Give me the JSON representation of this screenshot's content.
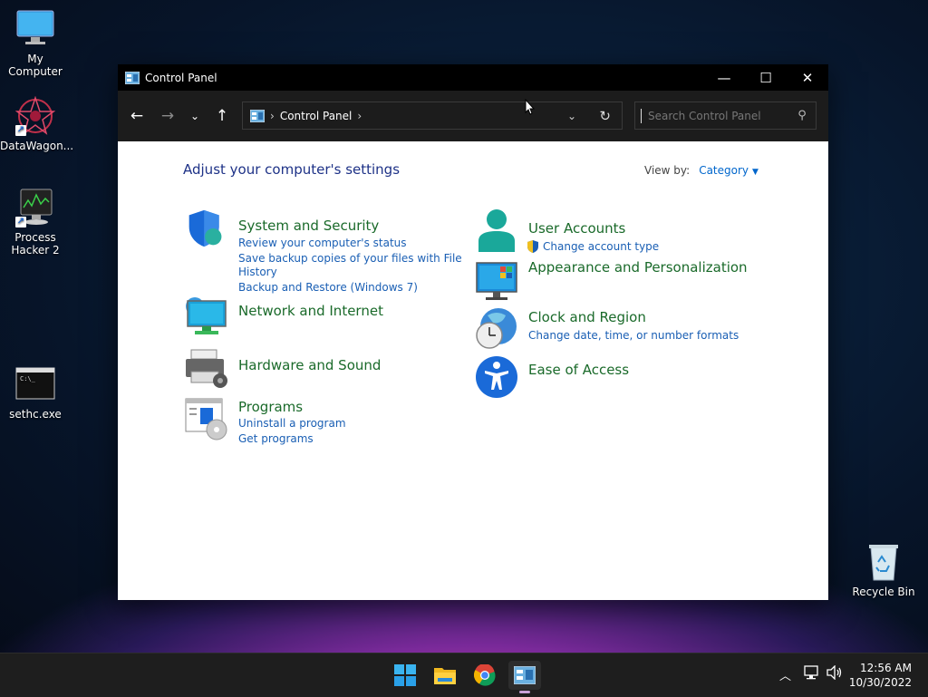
{
  "desktop": {
    "icons": [
      {
        "label": "My Computer",
        "icon": "monitor-icon"
      },
      {
        "label": "DataWagon...",
        "icon": "datawagon-icon"
      },
      {
        "label": "Process\nHacker 2",
        "icon": "process-hacker-icon"
      },
      {
        "label": "sethc.exe",
        "icon": "cmd-icon"
      },
      {
        "label": "Recycle Bin",
        "icon": "recycle-bin-icon"
      }
    ]
  },
  "window": {
    "title": "Control Panel",
    "address": {
      "crumb": "Control Panel",
      "sep": "›"
    },
    "search_placeholder": "Search Control Panel",
    "heading": "Adjust your computer's settings",
    "view_by_label": "View by:",
    "view_by_value": "Category"
  },
  "categories": {
    "system": {
      "title": "System and Security",
      "links": [
        "Review your computer's status",
        "Save backup copies of your files with File",
        "History",
        "Backup and Restore (Windows 7)"
      ]
    },
    "network": {
      "title": "Network and Internet"
    },
    "hardware": {
      "title": "Hardware and Sound"
    },
    "programs": {
      "title": "Programs",
      "links": [
        "Uninstall a program",
        "Get programs"
      ]
    },
    "users": {
      "title": "User Accounts",
      "links": [
        "Change account type"
      ]
    },
    "appearance": {
      "title": "Appearance and Personalization"
    },
    "clock": {
      "title": "Clock and Region",
      "links": [
        "Change date, time, or number formats"
      ]
    },
    "ease": {
      "title": "Ease of Access"
    }
  },
  "taskbar": {
    "items": [
      "start-icon",
      "file-explorer-icon",
      "chrome-icon",
      "control-panel-icon"
    ],
    "time": "12:56 AM",
    "date": "10/30/2022"
  },
  "colors": {
    "heading": "#1e3287",
    "category_title": "#1a6a2a",
    "link": "#1a5fb4",
    "titlebar": "#000000"
  }
}
